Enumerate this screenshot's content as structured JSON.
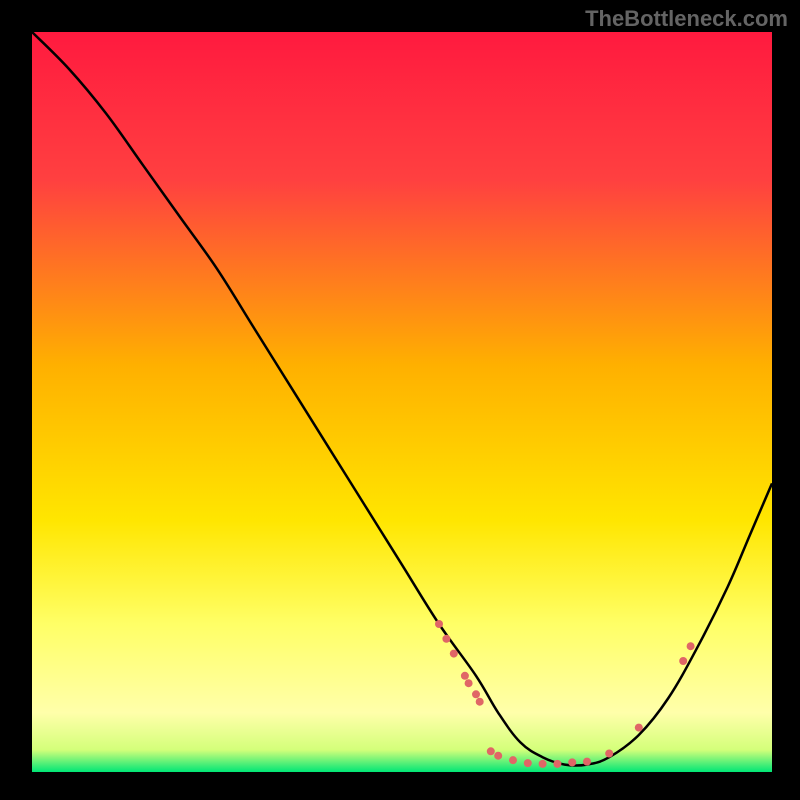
{
  "watermark": "TheBottleneck.com",
  "chart_data": {
    "type": "line",
    "title": "",
    "xlabel": "",
    "ylabel": "",
    "xlim": [
      0,
      100
    ],
    "ylim": [
      0,
      100
    ],
    "grid": false,
    "legend": false,
    "gradient_stops": [
      {
        "offset": 0,
        "color": "#ff1a3f"
      },
      {
        "offset": 20,
        "color": "#ff4040"
      },
      {
        "offset": 45,
        "color": "#ffb000"
      },
      {
        "offset": 66,
        "color": "#ffe600"
      },
      {
        "offset": 80,
        "color": "#ffff66"
      },
      {
        "offset": 92,
        "color": "#ffffaa"
      },
      {
        "offset": 97,
        "color": "#d4ff7a"
      },
      {
        "offset": 100,
        "color": "#00e676"
      }
    ],
    "series": [
      {
        "name": "curve",
        "x": [
          0,
          5,
          10,
          15,
          20,
          25,
          30,
          35,
          40,
          45,
          50,
          55,
          60,
          63,
          66,
          69,
          72,
          75,
          78,
          82,
          86,
          90,
          94,
          97,
          100
        ],
        "y": [
          100,
          95,
          89,
          82,
          75,
          68,
          60,
          52,
          44,
          36,
          28,
          20,
          13,
          8,
          4,
          2,
          1,
          1,
          2,
          5,
          10,
          17,
          25,
          32,
          39
        ]
      }
    ],
    "markers": [
      {
        "x": 55,
        "y": 20,
        "r": 4
      },
      {
        "x": 56,
        "y": 18,
        "r": 4
      },
      {
        "x": 57,
        "y": 16,
        "r": 4
      },
      {
        "x": 58.5,
        "y": 13,
        "r": 4
      },
      {
        "x": 59,
        "y": 12,
        "r": 4
      },
      {
        "x": 60,
        "y": 10.5,
        "r": 4
      },
      {
        "x": 60.5,
        "y": 9.5,
        "r": 4
      },
      {
        "x": 62,
        "y": 2.8,
        "r": 4
      },
      {
        "x": 63,
        "y": 2.2,
        "r": 4
      },
      {
        "x": 65,
        "y": 1.6,
        "r": 4
      },
      {
        "x": 67,
        "y": 1.2,
        "r": 4
      },
      {
        "x": 69,
        "y": 1.1,
        "r": 4
      },
      {
        "x": 71,
        "y": 1.1,
        "r": 4
      },
      {
        "x": 73,
        "y": 1.3,
        "r": 4
      },
      {
        "x": 75,
        "y": 1.4,
        "r": 4
      },
      {
        "x": 78,
        "y": 2.5,
        "r": 4
      },
      {
        "x": 82,
        "y": 6,
        "r": 4
      },
      {
        "x": 88,
        "y": 15,
        "r": 4
      },
      {
        "x": 89,
        "y": 17,
        "r": 4
      }
    ],
    "marker_color": "#e06666"
  }
}
